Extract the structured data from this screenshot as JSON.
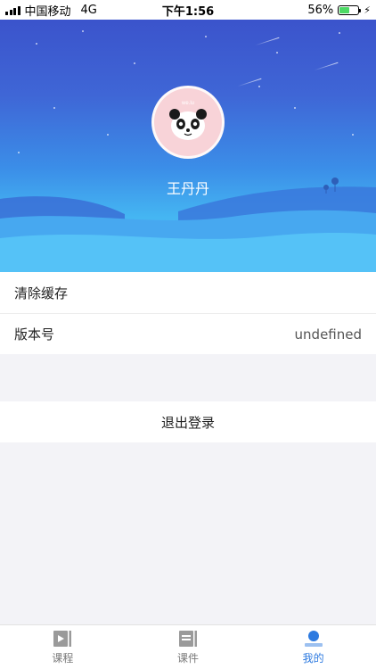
{
  "status_bar": {
    "carrier": "中国移动",
    "network": "4G",
    "time": "下午1:56",
    "battery_percent": "56%",
    "battery_level": 0.56
  },
  "profile": {
    "avatar_icon": "panda-avatar-icon",
    "avatar_caption": "we.lu",
    "name": "王丹丹"
  },
  "settings": {
    "clear_cache_label": "清除缓存",
    "version_label": "版本号",
    "version_value": "undefined"
  },
  "actions": {
    "logout_label": "退出登录"
  },
  "tabbar": {
    "tabs": [
      {
        "label": "课程",
        "icon": "play-video-icon",
        "active": false
      },
      {
        "label": "课件",
        "icon": "document-icon",
        "active": false
      },
      {
        "label": "我的",
        "icon": "person-icon",
        "active": true
      }
    ]
  },
  "colors": {
    "accent": "#2d7ae0",
    "hero_top": "#3a4fc9",
    "hero_bottom": "#5ccbf7",
    "avatar_bg": "#f8d3d8"
  }
}
